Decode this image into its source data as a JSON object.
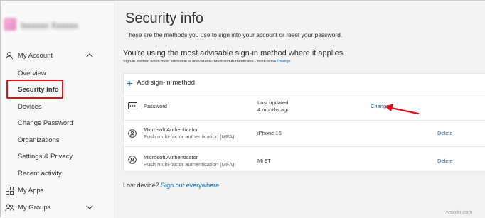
{
  "sidebar": {
    "profile_name": "Ixxxxxx Xxxxxx",
    "groups": {
      "my_account": "My Account",
      "my_apps": "My Apps",
      "my_groups": "My Groups"
    },
    "items": [
      {
        "label": "Overview"
      },
      {
        "label": "Security info"
      },
      {
        "label": "Devices"
      },
      {
        "label": "Change Password"
      },
      {
        "label": "Organizations"
      },
      {
        "label": "Settings & Privacy"
      },
      {
        "label": "Recent activity"
      }
    ]
  },
  "main": {
    "title": "Security info",
    "subtitle": "These are the methods you use to sign into your account or reset your password.",
    "advisable": "You're using the most advisable sign-in method where it applies.",
    "unavailable_text": "Sign-in method when most advisable is unavailable: Microsoft Authenticator - notification",
    "unavailable_link": "Change",
    "add_method": "Add sign-in method",
    "methods": [
      {
        "name": "Password",
        "detail_label": "Last updated:",
        "detail_value": "4 months ago",
        "action": "Change"
      },
      {
        "name": "Microsoft Authenticator",
        "description": "Push multi-factor authentication (MFA)",
        "detail": "iPhone 15",
        "action": "Delete"
      },
      {
        "name": "Microsoft Authenticator",
        "description": "Push multi-factor authentication (MFA)",
        "detail": "Mi 9T",
        "action": "Delete"
      }
    ],
    "lost_device": "Lost device?",
    "sign_out_link": "Sign out everywhere"
  },
  "watermark": "wsxdn.com",
  "colors": {
    "link": "#0067b8",
    "highlight": "#e0101a",
    "sidebar_bg": "#f8f8f8",
    "main_bg": "#f3f3f3"
  }
}
